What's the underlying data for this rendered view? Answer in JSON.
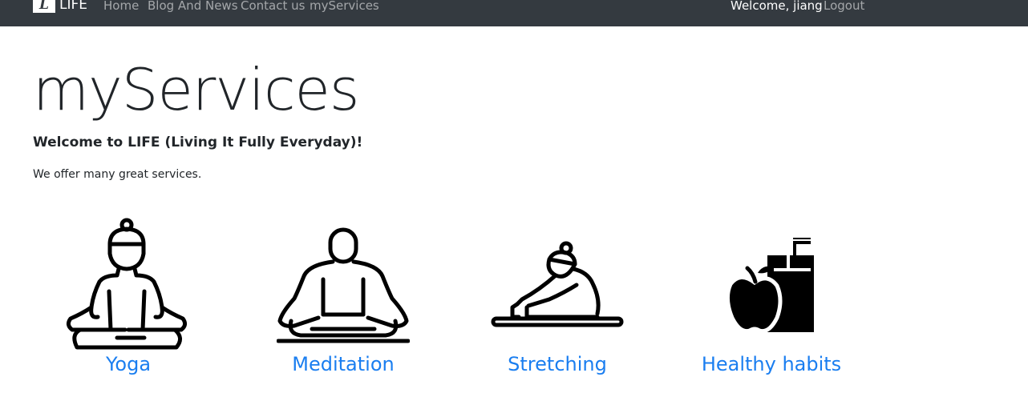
{
  "navbar": {
    "brand_logo": "L",
    "brand_name": "LIFE",
    "links": [
      "Home",
      "Blog And News",
      "Contact us",
      "myServices"
    ],
    "welcome": "Welcome, jiang",
    "logout": "Logout"
  },
  "main": {
    "title": "myServices",
    "welcome_heading": "Welcome to LIFE (Living It Fully Everyday)!",
    "intro": "We offer many great services."
  },
  "services": [
    {
      "label": "Yoga",
      "icon": "yoga-pose-icon"
    },
    {
      "label": "Meditation",
      "icon": "meditation-icon"
    },
    {
      "label": "Stretching",
      "icon": "stretching-icon"
    },
    {
      "label": "Healthy habits",
      "icon": "apple-juice-icon"
    }
  ],
  "colors": {
    "navbar_bg": "#343a40",
    "link": "#1a7ef0",
    "text": "#212529"
  }
}
